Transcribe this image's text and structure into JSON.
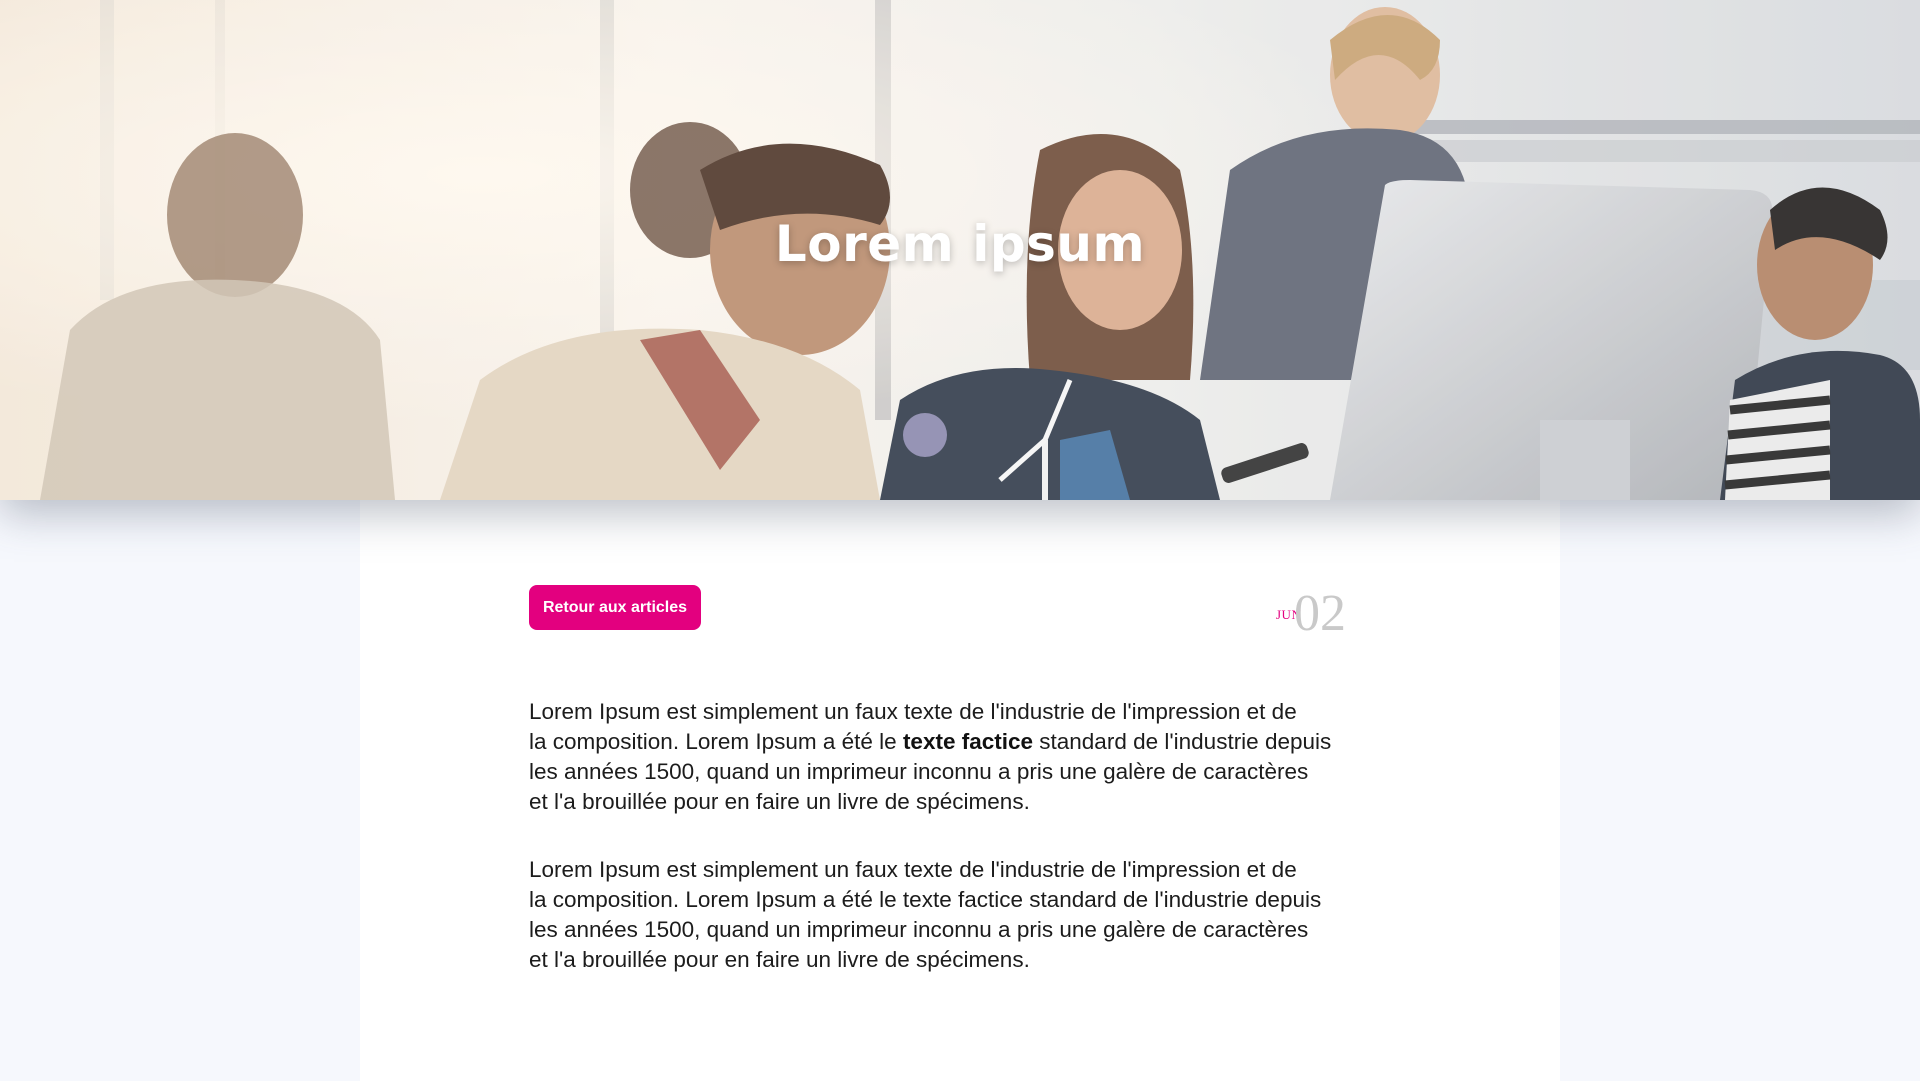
{
  "hero": {
    "title": "Lorem ipsum"
  },
  "actions": {
    "back_label": "Retour aux articles"
  },
  "date": {
    "month": "JUN",
    "day": "02"
  },
  "article": {
    "paragraph1": {
      "line1": "Lorem Ipsum est simplement un faux texte de l'industrie de l'impression et de",
      "line2_before": "la composition. Lorem Ipsum a été le ",
      "line2_bold": "texte factice",
      "line2_after": " standard de l'industrie depuis",
      "line3": "les années 1500, quand un imprimeur inconnu a pris une galère de caractères",
      "line4": "et l'a brouillée pour en faire un livre de spécimens."
    },
    "paragraph2": {
      "line1": "Lorem Ipsum est simplement un faux texte de l'industrie de l'impression et de",
      "line2": "la composition. Lorem Ipsum a été le texte factice standard de l'industrie depuis",
      "line3": "les années 1500, quand un imprimeur inconnu a pris une galère de caractères",
      "line4": "et l'a brouillée pour en faire un livre de spécimens."
    }
  },
  "colors": {
    "accent": "#e3007f",
    "page_background": "#f6f8fd",
    "card_background": "#ffffff",
    "date_day": "#c9c9c9"
  }
}
